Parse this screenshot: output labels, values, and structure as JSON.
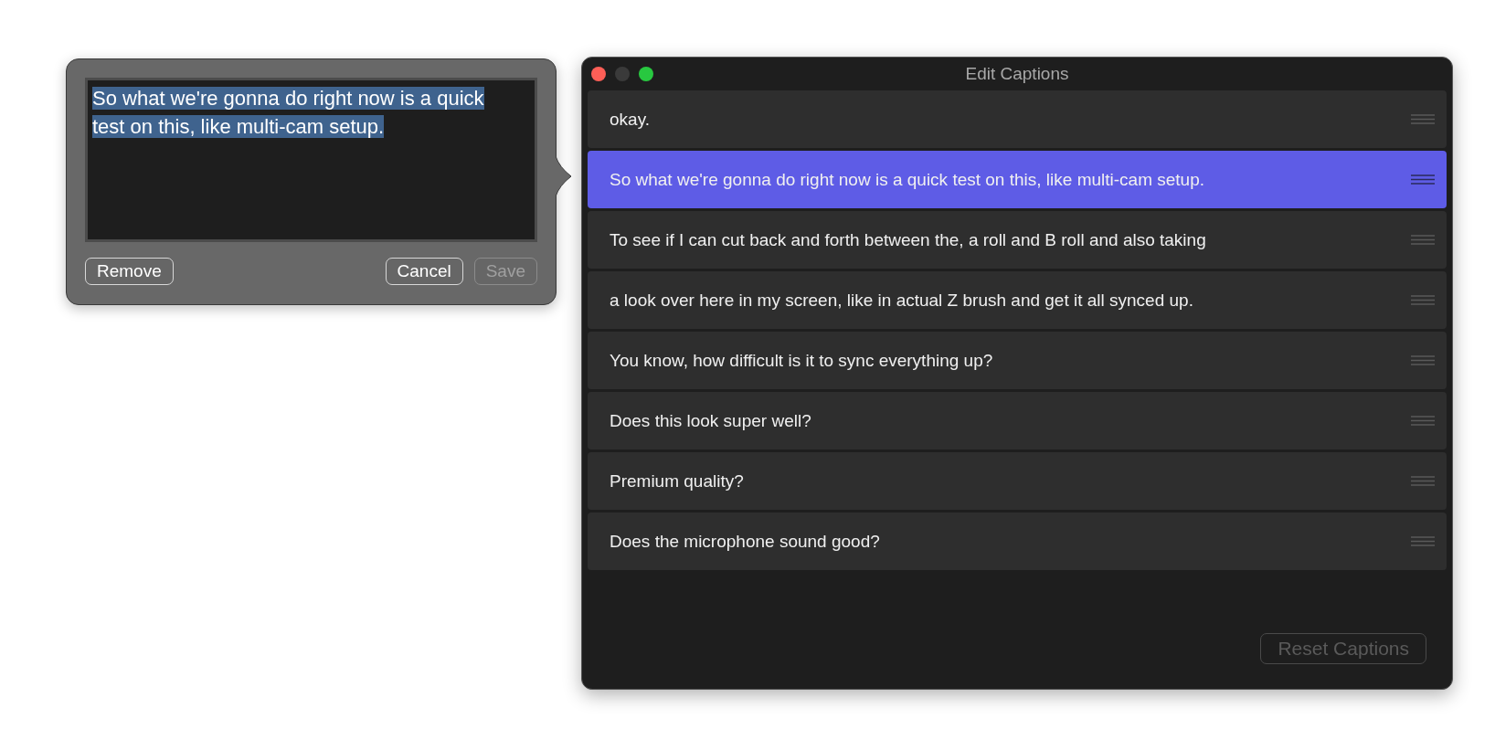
{
  "popover": {
    "text": "So what we're gonna do right now is a quick test on this, like multi-cam setup.",
    "text_selected": true,
    "buttons": [
      {
        "label": "Remove",
        "disabled": false
      },
      {
        "label": "Cancel",
        "disabled": false
      },
      {
        "label": "Save",
        "disabled": true
      }
    ]
  },
  "window": {
    "title": "Edit Captions"
  },
  "captions": [
    {
      "text": "okay.",
      "selected": false
    },
    {
      "text": "So what we're gonna do right now is a quick test on this, like multi-cam setup.",
      "selected": true
    },
    {
      "text": "To see if I can cut back and forth between the, a roll and B roll and also taking",
      "selected": false
    },
    {
      "text": "a look over here in my screen, like in actual Z brush and get it all synced up.",
      "selected": false
    },
    {
      "text": "You know, how difficult is it to sync everything up?",
      "selected": false
    },
    {
      "text": "Does this look super well?",
      "selected": false
    },
    {
      "text": "Premium quality?",
      "selected": false
    },
    {
      "text": "Does the microphone sound good?",
      "selected": false
    }
  ],
  "reset_button": {
    "label": "Reset Captions",
    "disabled": true
  }
}
